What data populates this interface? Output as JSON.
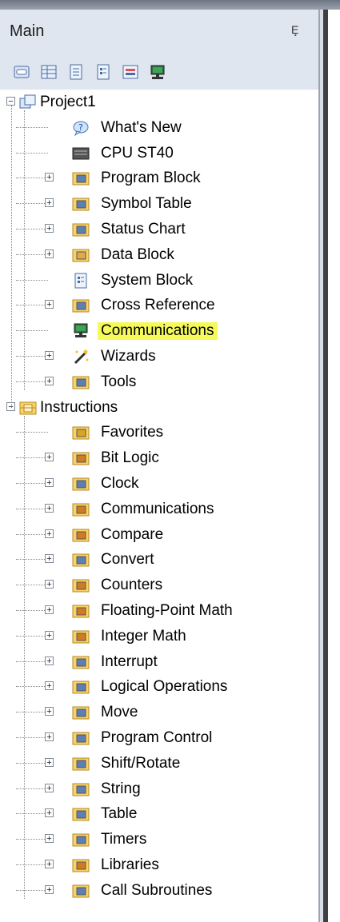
{
  "panel": {
    "title": "Main",
    "pin": "Ȩ"
  },
  "toolbar": {
    "buttons": [
      "symbol-table-icon",
      "status-chart-icon",
      "data-block-icon",
      "system-block-icon",
      "cross-reference-icon",
      "communications-icon"
    ]
  },
  "tree": {
    "project": {
      "label": "Project1",
      "items": [
        {
          "label": "What's New",
          "expandable": false,
          "icon": "help-icon"
        },
        {
          "label": "CPU ST40",
          "expandable": false,
          "icon": "cpu-icon"
        },
        {
          "label": "Program Block",
          "expandable": true,
          "icon": "program-block-icon"
        },
        {
          "label": "Symbol Table",
          "expandable": true,
          "icon": "symbol-table-icon"
        },
        {
          "label": "Status Chart",
          "expandable": true,
          "icon": "status-chart-icon"
        },
        {
          "label": "Data Block",
          "expandable": true,
          "icon": "data-block-icon"
        },
        {
          "label": "System Block",
          "expandable": false,
          "icon": "system-block-icon"
        },
        {
          "label": "Cross Reference",
          "expandable": true,
          "icon": "cross-reference-icon"
        },
        {
          "label": "Communications",
          "expandable": false,
          "icon": "communications-icon",
          "highlighted": true
        },
        {
          "label": "Wizards",
          "expandable": true,
          "icon": "wizard-icon"
        },
        {
          "label": "Tools",
          "expandable": true,
          "icon": "tools-icon"
        }
      ]
    },
    "instructions": {
      "label": "Instructions",
      "items": [
        {
          "label": "Favorites",
          "expandable": false,
          "icon": "favorites-icon"
        },
        {
          "label": "Bit Logic",
          "expandable": true,
          "icon": "bit-logic-icon"
        },
        {
          "label": "Clock",
          "expandable": true,
          "icon": "clock-icon"
        },
        {
          "label": "Communications",
          "expandable": true,
          "icon": "communications-instr-icon"
        },
        {
          "label": "Compare",
          "expandable": true,
          "icon": "compare-icon"
        },
        {
          "label": "Convert",
          "expandable": true,
          "icon": "convert-icon"
        },
        {
          "label": "Counters",
          "expandable": true,
          "icon": "counters-icon"
        },
        {
          "label": "Floating-Point Math",
          "expandable": true,
          "icon": "floating-point-math-icon"
        },
        {
          "label": "Integer Math",
          "expandable": true,
          "icon": "integer-math-icon"
        },
        {
          "label": "Interrupt",
          "expandable": true,
          "icon": "interrupt-icon"
        },
        {
          "label": "Logical Operations",
          "expandable": true,
          "icon": "logical-operations-icon"
        },
        {
          "label": "Move",
          "expandable": true,
          "icon": "move-icon"
        },
        {
          "label": "Program Control",
          "expandable": true,
          "icon": "program-control-icon"
        },
        {
          "label": "Shift/Rotate",
          "expandable": true,
          "icon": "shift-rotate-icon"
        },
        {
          "label": "String",
          "expandable": true,
          "icon": "string-icon"
        },
        {
          "label": "Table",
          "expandable": true,
          "icon": "table-icon"
        },
        {
          "label": "Timers",
          "expandable": true,
          "icon": "timers-icon"
        },
        {
          "label": "Libraries",
          "expandable": true,
          "icon": "libraries-icon"
        },
        {
          "label": "Call Subroutines",
          "expandable": true,
          "icon": "call-subroutines-icon"
        }
      ]
    }
  },
  "colors": {
    "highlight": "#f6f95a",
    "header_bg": "#dfe6ef"
  }
}
